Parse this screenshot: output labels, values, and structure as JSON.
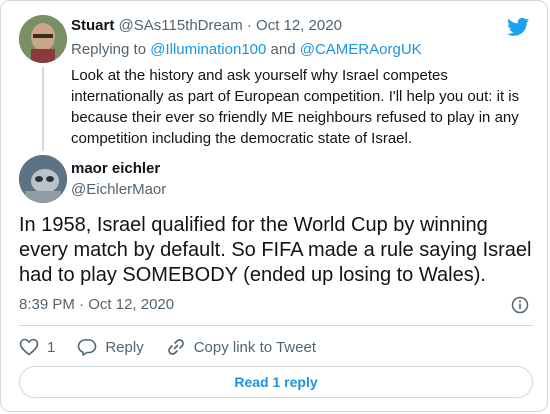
{
  "parent_tweet": {
    "name": "Stuart",
    "handle": "@SAs115thDream",
    "separator": "·",
    "date": "Oct 12, 2020",
    "replying_prefix": "Replying to",
    "replying_user1": "@Illumination100",
    "replying_and": "and",
    "replying_user2": "@CAMERAorgUK",
    "text": "Look at the history and ask yourself why Israel competes internationally as part of European competition. I'll help you out: it is because their ever so friendly ME neighbours refused to play in any competition including the democratic state of Israel."
  },
  "main_tweet": {
    "name": "maor eichler",
    "handle": "@EichlerMaor",
    "text": "In 1958, Israel qualified for the World Cup by winning every match by default. So FIFA made a rule saying Israel had to play SOMEBODY (ended up losing to Wales).",
    "time": "8:39 PM",
    "separator": "·",
    "date": "Oct 12, 2020"
  },
  "actions": {
    "like_count": "1",
    "reply_label": "Reply",
    "copy_label": "Copy link to Tweet"
  },
  "read_reply_label": "Read 1 reply",
  "icons": [
    "twitter-logo-icon",
    "info-icon",
    "heart-icon",
    "reply-icon",
    "link-icon"
  ],
  "colors": {
    "accent": "#1b95e0",
    "muted": "#536471",
    "border": "#cfd9de",
    "twitter_blue": "#1da1f2"
  }
}
